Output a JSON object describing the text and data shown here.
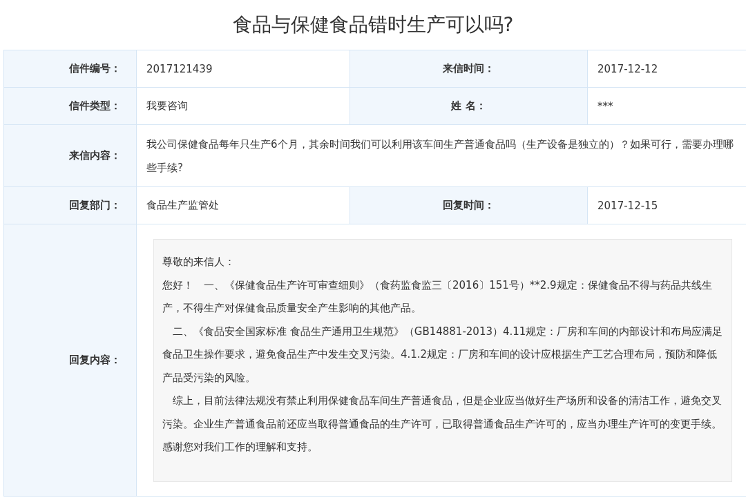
{
  "title": "食品与保健食品错时生产可以吗?",
  "rows": [
    {
      "kind": "pair",
      "items": [
        {
          "label": "信件编号：",
          "value": "2017121439"
        },
        {
          "label": "来信时间：",
          "value": "2017-12-12"
        }
      ]
    },
    {
      "kind": "pair",
      "items": [
        {
          "label": "信件类型：",
          "value": "我要咨询"
        },
        {
          "label": "姓 名：",
          "value": "***"
        }
      ]
    },
    {
      "kind": "wide",
      "label": "来信内容：",
      "value": "我公司保健食品每年只生产6个月，其余时间我们可以利用该车间生产普通食品吗（生产设备是独立的）？如果可行，需要办理哪些手续?"
    },
    {
      "kind": "pair",
      "items": [
        {
          "label": "回复部门：",
          "value": "食品生产监管处"
        },
        {
          "label": "回复时间：",
          "value": "2017-12-15"
        }
      ]
    },
    {
      "kind": "reply",
      "label": "回复内容：",
      "paragraphs": [
        "尊敬的来信人：",
        "您好！　一、《保健食品生产许可审查细则》（食药监食监三〔2016〕151号）**2.9规定：保健食品不得与药品共线生产，不得生产对保健食品质量安全产生影响的其他产品。",
        "　二、《食品安全国家标准 食品生产通用卫生规范》（GB14881-2013）4.11规定：厂房和车间的内部设计和布局应满足食品卫生操作要求，避免食品生产中发生交叉污染。4.1.2规定：厂房和车间的设计应根据生产工艺合理布局，预防和降低产品受污染的风险。",
        "　综上，目前法律法规没有禁止利用保健食品车间生产普通食品，但是企业应当做好生产场所和设备的清洁工作，避免交叉污染。企业生产普通食品前还应当取得普通食品的生产许可，已取得普通食品生产许可的，应当办理生产许可的变更手续。感谢您对我们工作的理解和支持。"
      ]
    }
  ]
}
